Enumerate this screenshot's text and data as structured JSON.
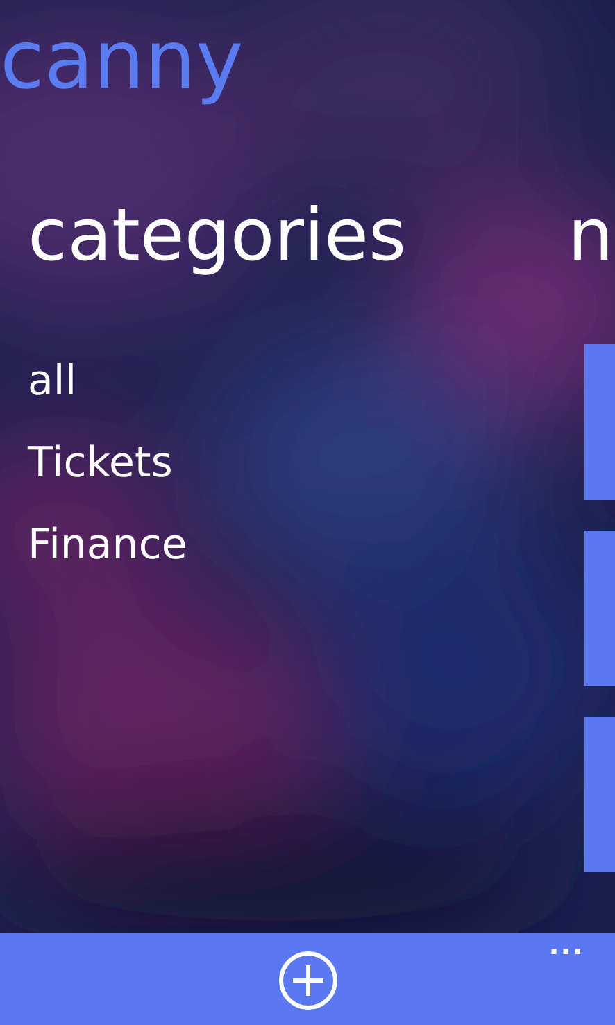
{
  "app_title": "canny",
  "sections": [
    {
      "heading": "categories",
      "items": [
        "all",
        "Tickets",
        "Finance"
      ]
    },
    {
      "heading": "n",
      "tiles": [
        {
          "kind": "tile"
        },
        {
          "kind": "tile"
        },
        {
          "kind": "tile"
        }
      ]
    }
  ],
  "app_bar": {
    "buttons": [
      {
        "kind": "add"
      }
    ],
    "more": "..."
  }
}
